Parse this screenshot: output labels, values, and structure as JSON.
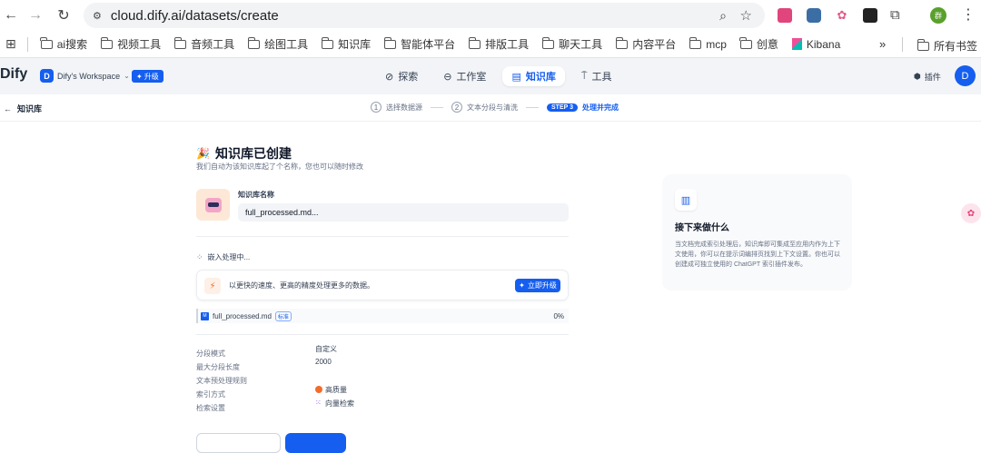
{
  "browser": {
    "url": "cloud.dify.ai/datasets/create",
    "bookmarks": [
      "ai搜索",
      "视频工具",
      "音频工具",
      "绘图工具",
      "知识库",
      "智能体平台",
      "排版工具",
      "聊天工具",
      "内容平台",
      "mcp",
      "创意",
      "Kibana"
    ],
    "all_bookmarks": "所有书签",
    "more": "»"
  },
  "app": {
    "logo": "Dify",
    "workspace_initial": "D",
    "workspace": "Dify's Workspace",
    "upgrade": "升级",
    "nav": [
      {
        "label": "探索",
        "icon": "compass-icon"
      },
      {
        "label": "工作室",
        "icon": "robot-icon"
      },
      {
        "label": "知识库",
        "icon": "book-icon"
      },
      {
        "label": "工具",
        "icon": "tool-icon"
      }
    ],
    "plugins": "插件",
    "avatar": "D"
  },
  "subheader": {
    "back_label": "知识库",
    "steps": [
      {
        "num": "1",
        "label": "选择数据源"
      },
      {
        "num": "2",
        "label": "文本分段与清洗"
      },
      {
        "num": "STEP 3",
        "label": "处理并完成"
      }
    ]
  },
  "main": {
    "emoji": "🎉",
    "title": "知识库已创建",
    "subtitle": "我们自动为该知识库起了个名称，您也可以随时修改",
    "name_label": "知识库名称",
    "name_value": "full_processed.md...",
    "embedding_status": "嵌入处理中...",
    "upgrade_banner": "以更快的速度、更高的精度处理更多的数据。",
    "upgrade_now": "立即升级",
    "file_name": "full_processed.md",
    "file_badge": "标准",
    "progress": "0%",
    "progress_fraction": 0,
    "settings": [
      {
        "label": "分段模式",
        "value": "自定义"
      },
      {
        "label": "最大分段长度",
        "value": "2000"
      },
      {
        "label": "文本预处理规则",
        "value": ""
      },
      {
        "label": "索引方式",
        "value": "高质量"
      },
      {
        "label": "检索设置",
        "value": "向量检索"
      }
    ]
  },
  "side_card": {
    "title": "接下来做什么",
    "body": "当文档完成索引处理后，知识库即可集成至应用内作为上下文使用，你可以在提示词编排页找到上下文设置。你也可以创建成可独立使用的 ChatGPT 索引插件发布。"
  }
}
